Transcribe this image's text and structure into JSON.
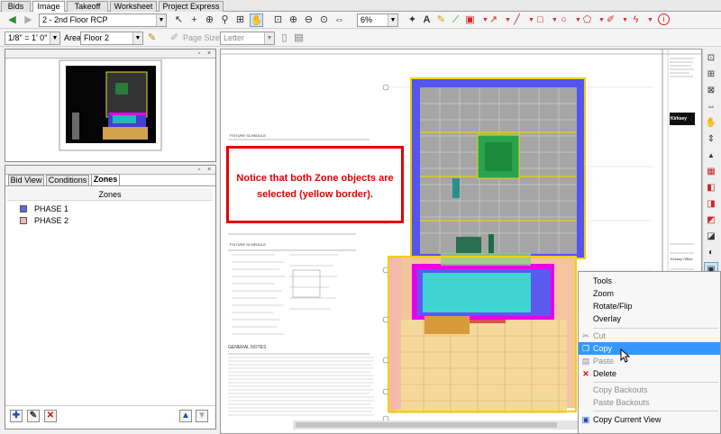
{
  "tabs": [
    "Bids",
    "Image",
    "Takeoff",
    "Worksheet",
    "Project Express"
  ],
  "active_tab": "Image",
  "toolbar1": {
    "page_select": "2 - 2nd Floor RCP",
    "zoom_select": "6%"
  },
  "toolbar2": {
    "scale_select": "1/8\" = 1' 0\"",
    "area_label": "Area",
    "area_select": "Floor 2",
    "page_size_label": "Page Size",
    "page_size_select": "Letter"
  },
  "bottom_panel": {
    "tabs": [
      "Bid View",
      "Conditions",
      "Zones"
    ],
    "active_tab": "Zones",
    "list_header": "Zones",
    "zones": [
      {
        "name": "PHASE 1",
        "color": "#6666ee"
      },
      {
        "name": "PHASE 2",
        "color": "#f4b6b6"
      }
    ]
  },
  "callout": {
    "text": "Notice that both Zone objects are selected (yellow border).",
    "color": "#e00000"
  },
  "drawing": {
    "titles": [
      "FIXTURE SCHEDULE",
      "FIXTURE SCHEDULE",
      "GENERAL NOTES"
    ],
    "title_block_logo": "Kirksey",
    "title_block_text": "Kirksey Office"
  },
  "context_menu": {
    "items": [
      {
        "label": "Tools",
        "enabled": true,
        "highlighted": false,
        "icon": ""
      },
      {
        "label": "Zoom",
        "enabled": true,
        "highlighted": false,
        "icon": ""
      },
      {
        "label": "Rotate/Flip",
        "enabled": true,
        "highlighted": false,
        "icon": ""
      },
      {
        "label": "Overlay",
        "enabled": true,
        "highlighted": false,
        "icon": ""
      },
      {
        "label": "Cut",
        "enabled": false,
        "highlighted": false,
        "icon": "scissors-icon"
      },
      {
        "label": "Copy",
        "enabled": true,
        "highlighted": true,
        "icon": "copy-icon"
      },
      {
        "label": "Paste",
        "enabled": false,
        "highlighted": false,
        "icon": "paste-icon"
      },
      {
        "label": "Delete",
        "enabled": true,
        "highlighted": false,
        "icon": "delete-icon"
      },
      {
        "label": "Copy Backouts",
        "enabled": false,
        "highlighted": false,
        "icon": ""
      },
      {
        "label": "Paste Backouts",
        "enabled": false,
        "highlighted": false,
        "icon": ""
      },
      {
        "label": "Copy Current View",
        "enabled": true,
        "highlighted": false,
        "icon": "copy-view-icon"
      }
    ]
  },
  "colors": {
    "phase1": "#5b5bf0",
    "phase2": "#f7c8a0",
    "selection_border": "#f0d000",
    "accent": "#3399ff"
  }
}
